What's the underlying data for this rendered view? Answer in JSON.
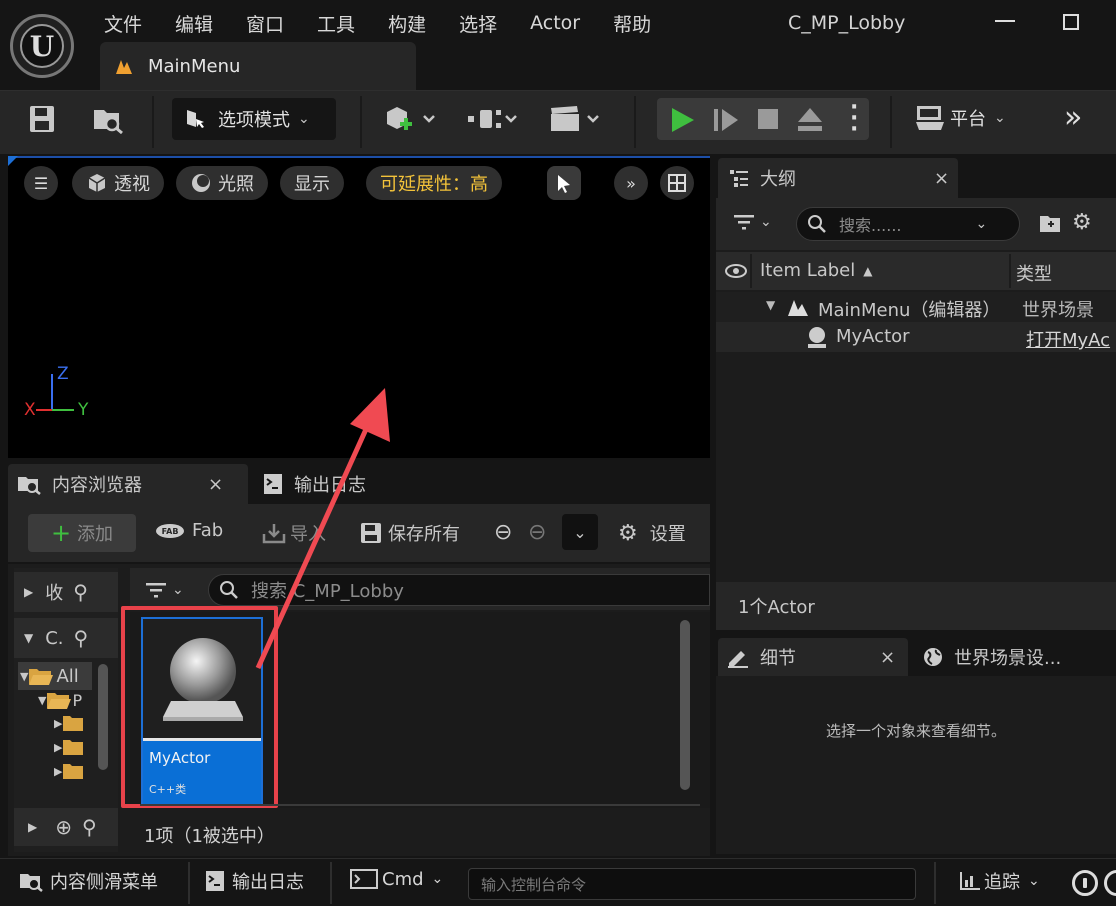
{
  "menu": [
    "文件",
    "编辑",
    "窗口",
    "工具",
    "构建",
    "选择",
    "Actor",
    "帮助"
  ],
  "window_title": "C_MP_Lobby",
  "doc_tab": {
    "label": "MainMenu"
  },
  "toolbar": {
    "mode_label": "选项模式",
    "platform_label": "平台"
  },
  "viewport": {
    "perspective": "透视",
    "lighting": "光照",
    "show": "显示",
    "scalability": "可延展性：高",
    "axis_z": "Z",
    "axis_y": "Y",
    "axis_x": "X"
  },
  "outliner": {
    "tab_label": "大纲",
    "search_placeholder": "搜索......",
    "col_label": "Item Label",
    "col_type": "类型",
    "rows": [
      {
        "label": "MainMenu（编辑器）",
        "type": "世界场景"
      },
      {
        "label": "MyActor",
        "type": "打开MyAc"
      }
    ],
    "footer": "1个Actor"
  },
  "details": {
    "tab_label": "细节",
    "world_tab_label": "世界场景设...",
    "empty_text": "选择一个对象来查看细节。"
  },
  "content_browser": {
    "tab_label": "内容浏览器",
    "log_tab_label": "输出日志",
    "add_label": "添加",
    "fab_label": "Fab",
    "import_label": "导入",
    "save_all_label": "保存所有",
    "settings_label": "设置",
    "source_fav": "收",
    "source_c": "C.",
    "tree_all": "All",
    "tree_p": "P",
    "search_placeholder": "搜索 C_MP_Lobby",
    "asset": {
      "name": "MyActor",
      "type": "C++类"
    },
    "status": "1项（1被选中）"
  },
  "statusbar": {
    "drawer": "内容侧滑菜单",
    "output_log": "输出日志",
    "cmd": "Cmd",
    "console_placeholder": "输入控制台命令",
    "trace": "追踪"
  },
  "colors": {
    "accent_blue": "#0a6fd6",
    "highlight_red": "#e8424a",
    "play_green": "#3fbf3f",
    "scalability_yellow": "#f3c33a"
  }
}
